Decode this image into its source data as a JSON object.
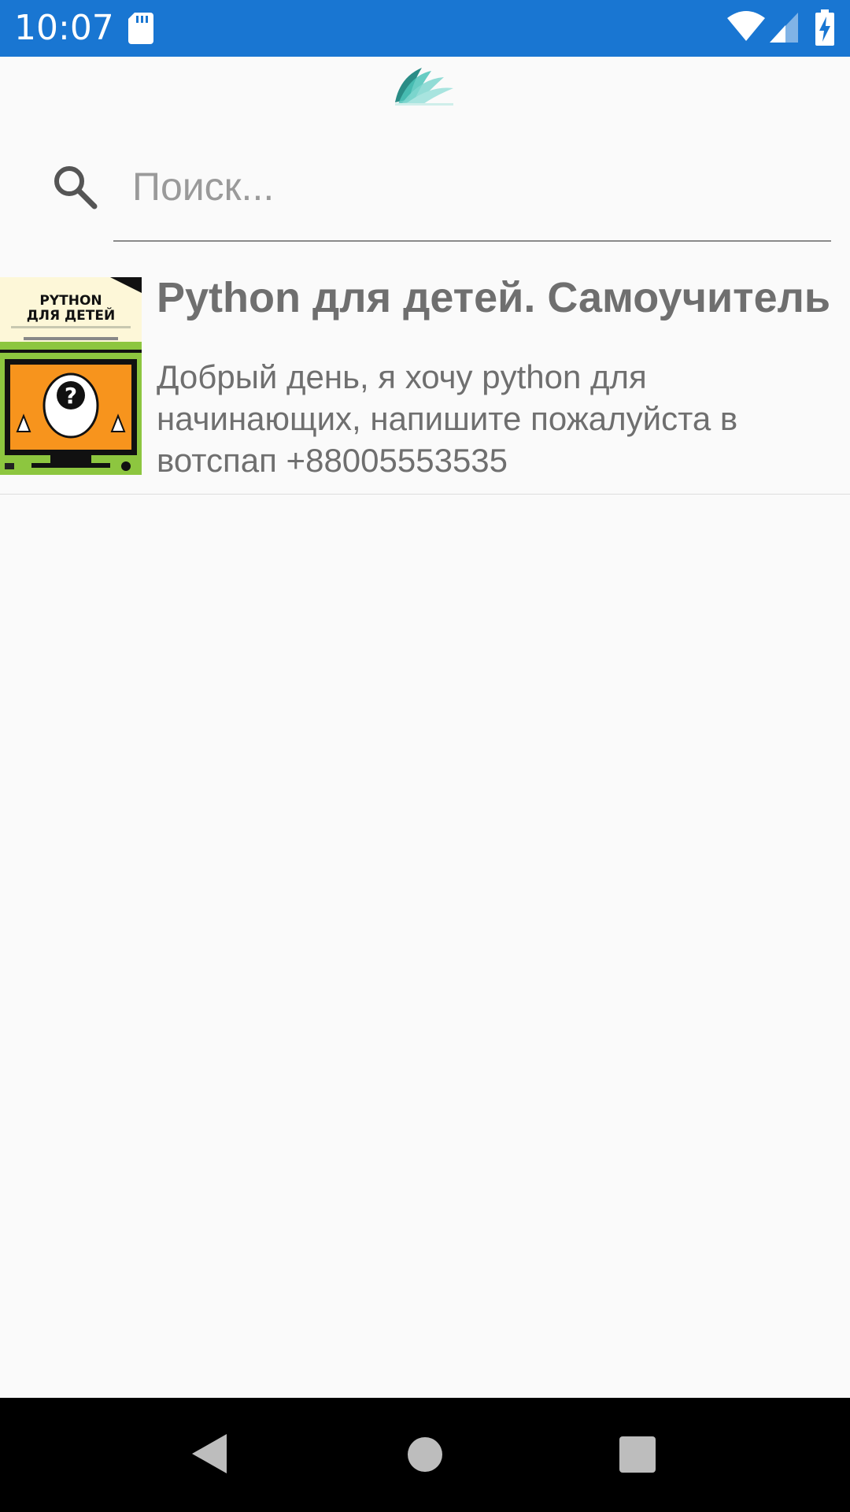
{
  "status_bar": {
    "time": "10:07",
    "icons": [
      "sd-card-icon",
      "wifi-icon",
      "cell-signal-icon",
      "battery-charging-icon"
    ],
    "background": "#1976d2"
  },
  "header": {
    "logo_icon": "book-logo-icon",
    "logo_color": "#4cc3b8"
  },
  "search": {
    "icon": "search-icon",
    "placeholder": "Поиск...",
    "value": ""
  },
  "results": [
    {
      "cover": {
        "title_lines": [
          "PYTHON",
          "ДЛЯ ДЕТЕЙ"
        ],
        "colors": {
          "top": "#fdf7d8",
          "screen": "#f7941d",
          "bottom": "#8dc63f"
        }
      },
      "title": "Python для детей. Самоучитель по программированию",
      "description": "Добрый день, я хочу python для начинающих, напишите пожалуйста в вотспап +88005553535"
    }
  ],
  "nav_bar": {
    "icons": [
      "back-icon",
      "home-icon",
      "recents-icon"
    ]
  }
}
